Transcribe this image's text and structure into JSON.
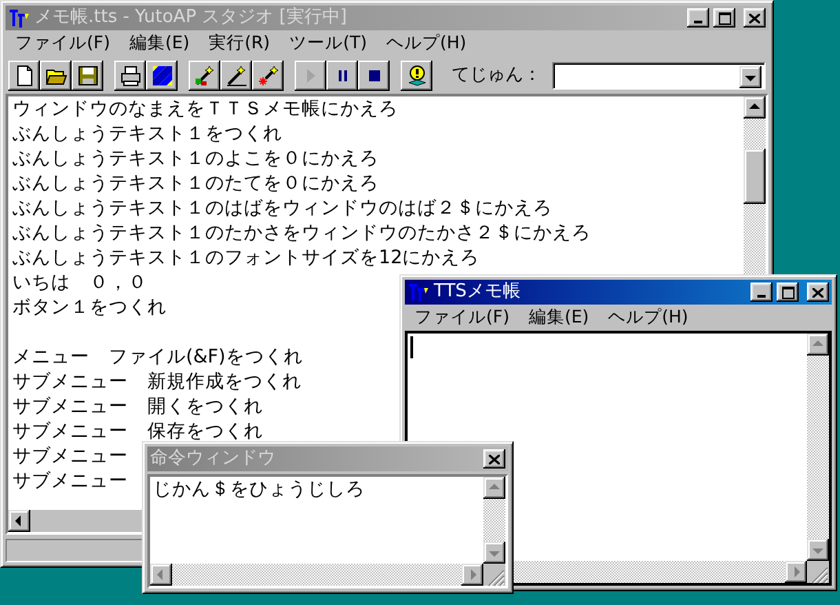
{
  "main_window": {
    "title": "メモ帳.tts - YutoAP スタジオ [実行中]",
    "active": false,
    "menu": [
      "ファイル(F)",
      "編集(E)",
      "実行(R)",
      "ツール(T)",
      "ヘルプ(H)"
    ],
    "toolbar_groups": [
      [
        {
          "kind": "new",
          "disabled": false
        },
        {
          "kind": "open",
          "disabled": false
        },
        {
          "kind": "save",
          "disabled": false
        }
      ],
      [
        {
          "kind": "print",
          "disabled": false
        },
        {
          "kind": "block",
          "disabled": false
        }
      ],
      [
        {
          "kind": "wand_color",
          "disabled": false
        },
        {
          "kind": "wand_line",
          "disabled": false
        },
        {
          "kind": "wand_spark",
          "disabled": false
        }
      ],
      [
        {
          "kind": "play",
          "disabled": true
        },
        {
          "kind": "pause",
          "disabled": false
        },
        {
          "kind": "stop",
          "disabled": false
        }
      ],
      [
        {
          "kind": "bulb",
          "disabled": false
        }
      ]
    ],
    "procedure_label": "てじゅん：",
    "lines": [
      {
        "kind": "text",
        "text": "ウィンドウのなまえをＴＴＳメモ帳にかえろ"
      },
      {
        "kind": "text",
        "text": "ぶんしょうテキスト１をつくれ"
      },
      {
        "kind": "text",
        "text": "ぶんしょうテキスト１のよこを０にかえろ"
      },
      {
        "kind": "text",
        "text": "ぶんしょうテキスト１のたてを０にかえろ"
      },
      {
        "kind": "text",
        "text": "ぶんしょうテキスト１のはばをウィンドウのはば２＄にかえろ"
      },
      {
        "kind": "text",
        "text": "ぶんしょうテキスト１のたかさをウィンドウのたかさ２＄にかえろ"
      },
      {
        "kind": "text",
        "text": "ぶんしょうテキスト１のフォントサイズを12にかえろ"
      },
      {
        "kind": "text",
        "text": "いちは　０，０"
      },
      {
        "kind": "text",
        "text": "ボタン１をつくれ"
      },
      {
        "kind": "blank"
      },
      {
        "kind": "text",
        "text": "メニュー　ファイル(&F)をつくれ"
      },
      {
        "kind": "text",
        "text": "サブメニュー　新規作成をつくれ"
      },
      {
        "kind": "text",
        "text": "サブメニュー　開くをつくれ"
      },
      {
        "kind": "text",
        "text": "サブメニュー　保存をつくれ"
      },
      {
        "kind": "text",
        "text": "サブメニュー"
      },
      {
        "kind": "text",
        "text": "サブメニュー"
      }
    ]
  },
  "tts_window": {
    "title": "TTSメモ帳",
    "active": true,
    "menu": [
      "ファイル(F)",
      "編集(E)",
      "ヘルプ(H)"
    ]
  },
  "command_window": {
    "title": "命令ウィンドウ",
    "active": false,
    "text": "じかん＄をひょうじしろ"
  }
}
